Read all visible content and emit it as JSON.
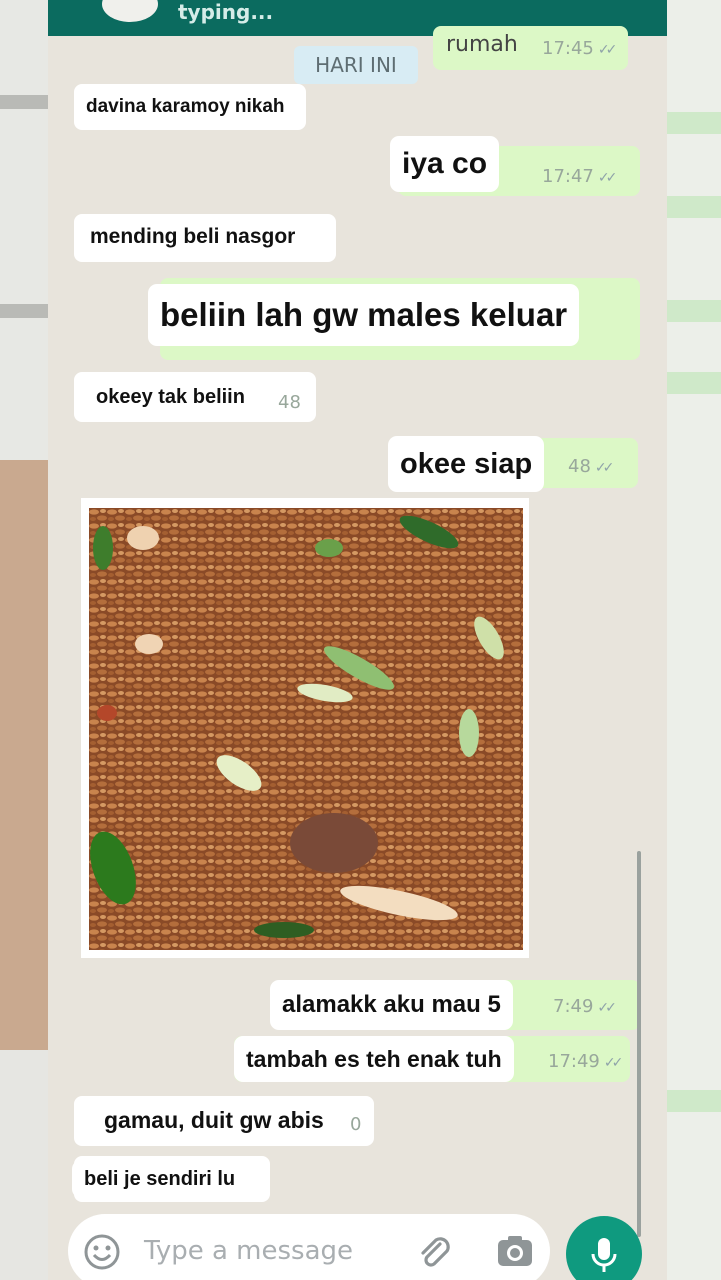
{
  "header": {
    "status": "typing...",
    "avatar_icon": "contact-avatar-icon"
  },
  "chat": {
    "date_chip": "HARI INI",
    "messages": [
      {
        "id": "m1",
        "direction": "out",
        "text": "rumah",
        "time": "17:45"
      },
      {
        "id": "m2",
        "direction": "in",
        "caption": "davina karamoy nikah"
      },
      {
        "id": "m3",
        "direction": "out",
        "caption": "iya co",
        "time": "17:47"
      },
      {
        "id": "m4",
        "direction": "in",
        "caption": "mending beli nasgor"
      },
      {
        "id": "m5",
        "direction": "out",
        "caption": "beliin lah gw males keluar"
      },
      {
        "id": "m6",
        "direction": "in",
        "caption": "okeey tak beliin",
        "time": "48"
      },
      {
        "id": "m7",
        "direction": "out",
        "caption": "okee siap",
        "time": "48"
      },
      {
        "id": "m8",
        "direction": "in",
        "type": "image",
        "image_icon": "fried-rice-photo"
      },
      {
        "id": "m9",
        "direction": "out",
        "caption": "alamakk aku mau 5",
        "time": "7:49"
      },
      {
        "id": "m10",
        "direction": "out",
        "caption": "tambah es teh enak tuh",
        "time": "17:49"
      },
      {
        "id": "m11",
        "direction": "in",
        "caption": "gamau, duit gw abis",
        "time": "0"
      },
      {
        "id": "m12",
        "direction": "in",
        "caption": "beli je sendiri lu"
      }
    ]
  },
  "composer": {
    "placeholder": "Type a message",
    "emoji_icon": "emoji-icon",
    "attach_icon": "paperclip-icon",
    "camera_icon": "camera-icon",
    "mic_icon": "microphone-icon"
  },
  "colors": {
    "header": "#0b6b5f",
    "outgoing_bubble": "#dcf8c6",
    "incoming_bubble": "#ffffff",
    "mic_button": "#0f9a7f",
    "chat_background": "#e8e4dc"
  }
}
